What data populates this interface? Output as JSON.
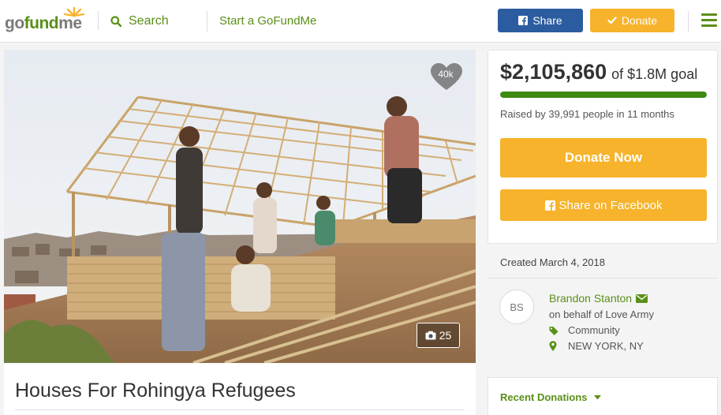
{
  "header": {
    "logo_part1": "go",
    "logo_part2": "fund",
    "logo_part3": "me",
    "search_label": "Search",
    "start_label": "Start a GoFundMe",
    "share_label": "Share",
    "donate_label": "Donate"
  },
  "campaign": {
    "title": "Houses For Rohingya Refugees",
    "hearts": "40k",
    "photo_count": "25",
    "raised": "$2,105,860",
    "goal_text": "of $1.8M goal",
    "progress_fraction": 1.0,
    "raised_by": "Raised by 39,991 people in 11 months",
    "donate_now_label": "Donate Now",
    "share_facebook_label": "Share on Facebook",
    "created": "Created March 4, 2018"
  },
  "organizer": {
    "initials": "BS",
    "name": "Brandon Stanton",
    "behalf": "on behalf of Love Army",
    "category": "Community",
    "location": "NEW YORK, NY"
  },
  "recent_donations_label": "Recent Donations",
  "colors": {
    "brand_green": "#5a8f18",
    "progress_green": "#3f8a13",
    "donate_orange": "#f7b32b",
    "facebook_blue": "#2c5ca0"
  },
  "icons": [
    "sun-logo-icon",
    "search-icon",
    "facebook-icon",
    "check-icon",
    "menu-icon",
    "heart-icon",
    "camera-icon",
    "envelope-icon",
    "tag-icon",
    "map-pin-icon",
    "caret-down-icon"
  ]
}
